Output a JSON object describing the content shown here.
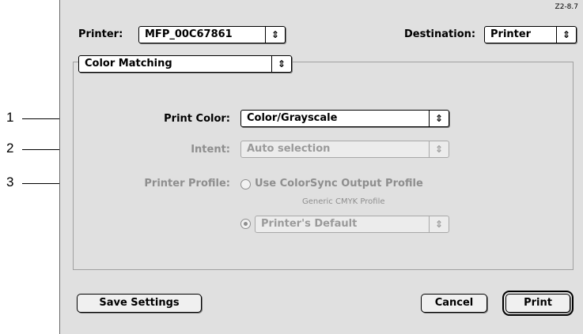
{
  "callouts": [
    "1",
    "2",
    "3"
  ],
  "version": "Z2-8.7",
  "printer": {
    "label": "Printer:",
    "value": "MFP_00C67861"
  },
  "destination": {
    "label": "Destination:",
    "value": "Printer"
  },
  "panel": {
    "value": "Color Matching"
  },
  "print_color": {
    "label": "Print Color:",
    "value": "Color/Grayscale"
  },
  "intent": {
    "label": "Intent:",
    "value": "Auto selection"
  },
  "printer_profile": {
    "label": "Printer Profile:",
    "option_colorsync": "Use ColorSync Output Profile",
    "colorsync_profile": "Generic CMYK Profile",
    "option_default_value": "Printer's Default"
  },
  "buttons": {
    "save": "Save Settings",
    "cancel": "Cancel",
    "print": "Print"
  },
  "arrow_glyph": "⬍"
}
